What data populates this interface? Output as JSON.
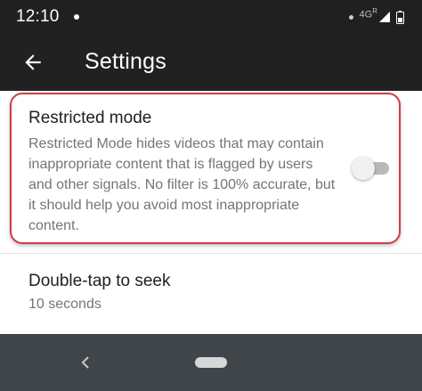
{
  "status_bar": {
    "time": "12:10",
    "network_label": "4G",
    "network_sub": "R"
  },
  "app_bar": {
    "title": "Settings"
  },
  "settings": {
    "restricted_mode": {
      "title": "Restricted mode",
      "description": "Restricted Mode hides videos that may contain inappropriate content that is flagged by users and other signals. No filter is 100% accurate, but it should help you avoid most inappropriate content.",
      "enabled": false
    },
    "double_tap": {
      "title": "Double-tap to seek",
      "value": "10 seconds"
    }
  },
  "colors": {
    "status_bar": "#202020",
    "app_bar": "#212121",
    "highlight": "#cf3d43",
    "nav_bar": "#3f4549",
    "secondary_text": "#757575"
  },
  "icons": {
    "back": "arrow-left-icon",
    "signal": "signal-icon",
    "battery": "battery-icon",
    "notification": "notification-dot-icon",
    "nav_back": "nav-back-icon",
    "nav_home": "home-pill-icon"
  }
}
